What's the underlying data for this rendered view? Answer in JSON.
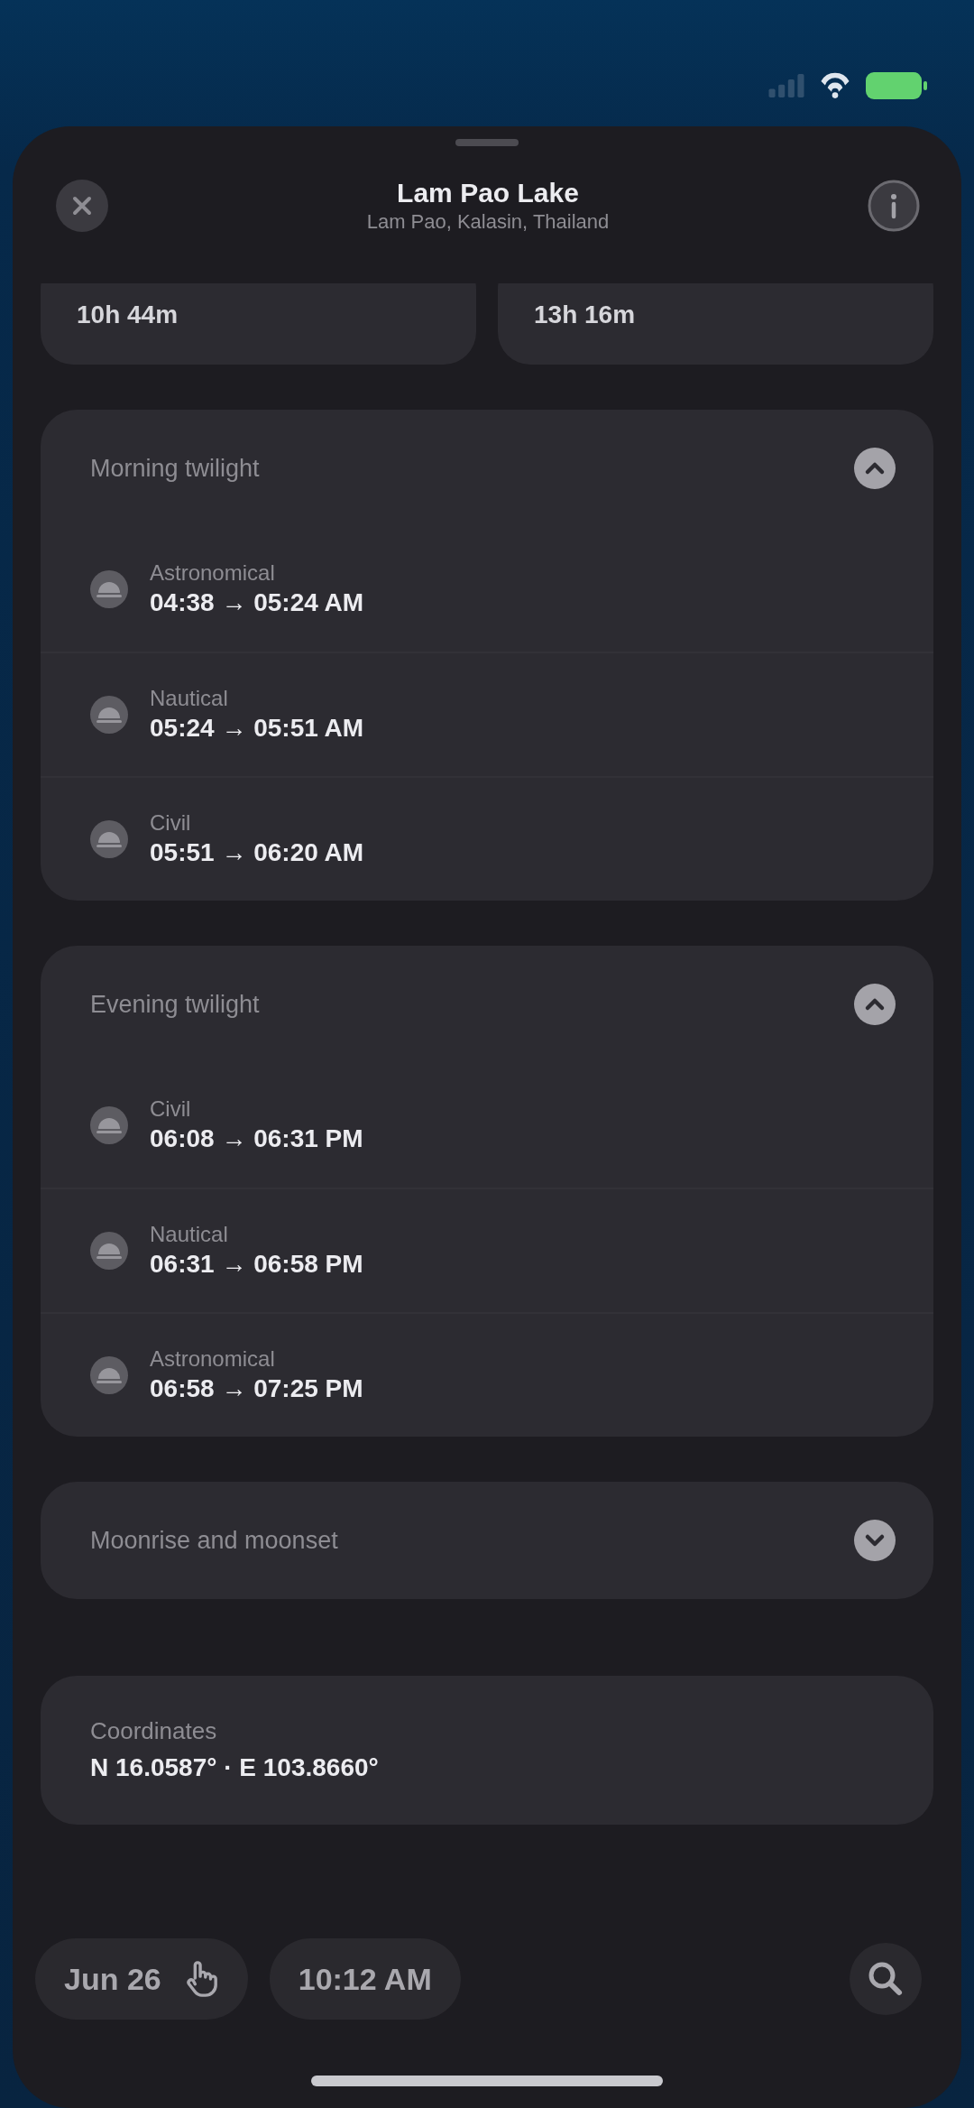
{
  "header": {
    "title": "Lam Pao Lake",
    "subtitle": "Lam Pao, Kalasin, Thailand"
  },
  "summary_tiles": [
    {
      "value": "10h 44m"
    },
    {
      "value": "13h 16m"
    }
  ],
  "sections": [
    {
      "title": "Morning twilight",
      "expanded": true,
      "rows": [
        {
          "label": "Astronomical",
          "time": "04:38 → 05:24 AM"
        },
        {
          "label": "Nautical",
          "time": "05:24 → 05:51 AM"
        },
        {
          "label": "Civil",
          "time": "05:51 → 06:20 AM"
        }
      ]
    },
    {
      "title": "Evening twilight",
      "expanded": true,
      "rows": [
        {
          "label": "Civil",
          "time": "06:08 → 06:31 PM"
        },
        {
          "label": "Nautical",
          "time": "06:31 → 06:58 PM"
        },
        {
          "label": "Astronomical",
          "time": "06:58 → 07:25 PM"
        }
      ]
    },
    {
      "title": "Moonrise and moonset",
      "expanded": false
    }
  ],
  "coordinates": {
    "label": "Coordinates",
    "value": "N 16.0587° · E 103.8660°"
  },
  "toolbar": {
    "date": "Jun 26",
    "time": "10:12 AM"
  }
}
